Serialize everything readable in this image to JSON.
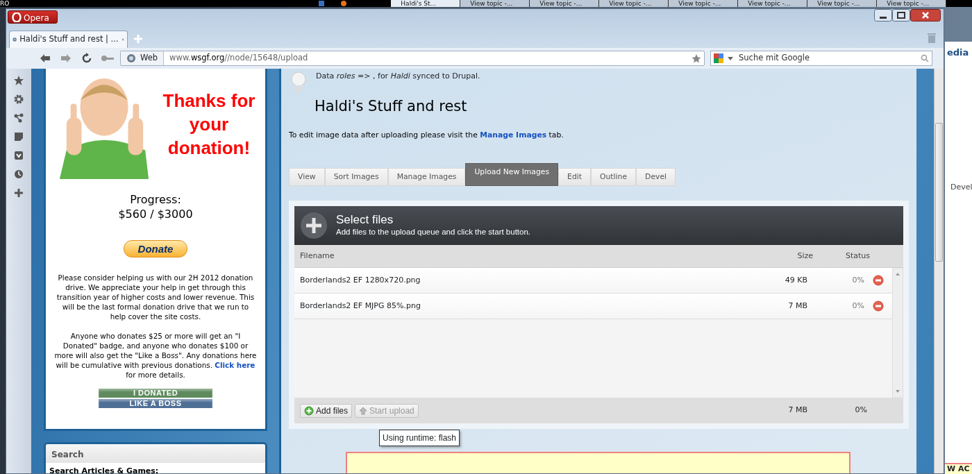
{
  "taskbar": {
    "corner_text": "RO",
    "buttons": [
      {
        "label": "Haldi's St...",
        "selected": true
      },
      {
        "label": "View topic -...",
        "selected": false
      },
      {
        "label": "View topic -...",
        "selected": false
      },
      {
        "label": "View topic -...",
        "selected": false
      },
      {
        "label": "View topic -...",
        "selected": false
      },
      {
        "label": "View topic -...",
        "selected": false
      },
      {
        "label": "View topic -...",
        "selected": false
      },
      {
        "label": "View topic -...",
        "selected": false
      }
    ]
  },
  "background_window": {
    "header_text": "edia",
    "tab_text": "Devel",
    "banner_text": "W AC"
  },
  "browser": {
    "menu_button": "Opera",
    "tab": {
      "title": "Haldi's Stuff and rest | ...",
      "selected": true
    },
    "url": "www.**wsgf.org**//node/15648/upload",
    "site_button": "Web",
    "search": {
      "placeholder": "Suche mit Google"
    }
  },
  "donation": {
    "thanks": "Thanks for your donation!",
    "progress_label": "Progress:",
    "progress_value": "$560 / $3000",
    "donate_button": "Donate",
    "appeal": "Please consider helping us with our 2H 2012 donation drive. We appreciate your help in get through this transition year of higher costs and lower revenue. This will be the last formal donation drive that we run to help cover the site costs.",
    "badges_note": {
      "before": "Anyone who donates $25 or more will get an \"I Donated\" badge, and anyone who donates $100 or more will also get the \"Like a Boss\". Any donations here will be cumulative with previous donations.",
      "link": "Click here",
      "after": "for more details."
    },
    "badges": [
      {
        "label": "I DONATED",
        "color": "#5e8a5e"
      },
      {
        "label": "LIKE A BOSS",
        "color": "#4e6e96"
      }
    ]
  },
  "search_block": {
    "title": "Search",
    "label": "Search Articles & Games:"
  },
  "message": "Data *roles =>* , for *Haldi* synced to Drupal.",
  "page_title": "Haldi's Stuff and rest",
  "hint": {
    "before": "To edit image data after uploading please visit the",
    "link": "Manage Images",
    "after": "tab."
  },
  "tabs": [
    {
      "label": "View",
      "selected": false
    },
    {
      "label": "Sort Images",
      "selected": false
    },
    {
      "label": "Manage Images",
      "selected": false
    },
    {
      "label": "Upload New Images",
      "selected": true
    },
    {
      "label": "Edit",
      "selected": false
    },
    {
      "label": "Outline",
      "selected": false
    },
    {
      "label": "Devel",
      "selected": false
    }
  ],
  "uploader": {
    "title": "Select files",
    "subtitle": "Add files to the upload queue and click the start button.",
    "columns": [
      "Filename",
      "Size",
      "Status"
    ],
    "files": [
      {
        "name": "Borderlands2 EF 1280x720.png",
        "size": "49 KB",
        "status": "0%"
      },
      {
        "name": "Borderlands2 EF MJPG 85%.png",
        "size": "7 MB",
        "status": "0%"
      }
    ],
    "buttons": [
      {
        "label": "Add files",
        "kind": "add",
        "disabled": false
      },
      {
        "label": "Start upload",
        "kind": "start",
        "disabled": true
      }
    ],
    "total_size": "7 MB",
    "total_status": "0%",
    "tooltip": "Using runtime: flash"
  }
}
